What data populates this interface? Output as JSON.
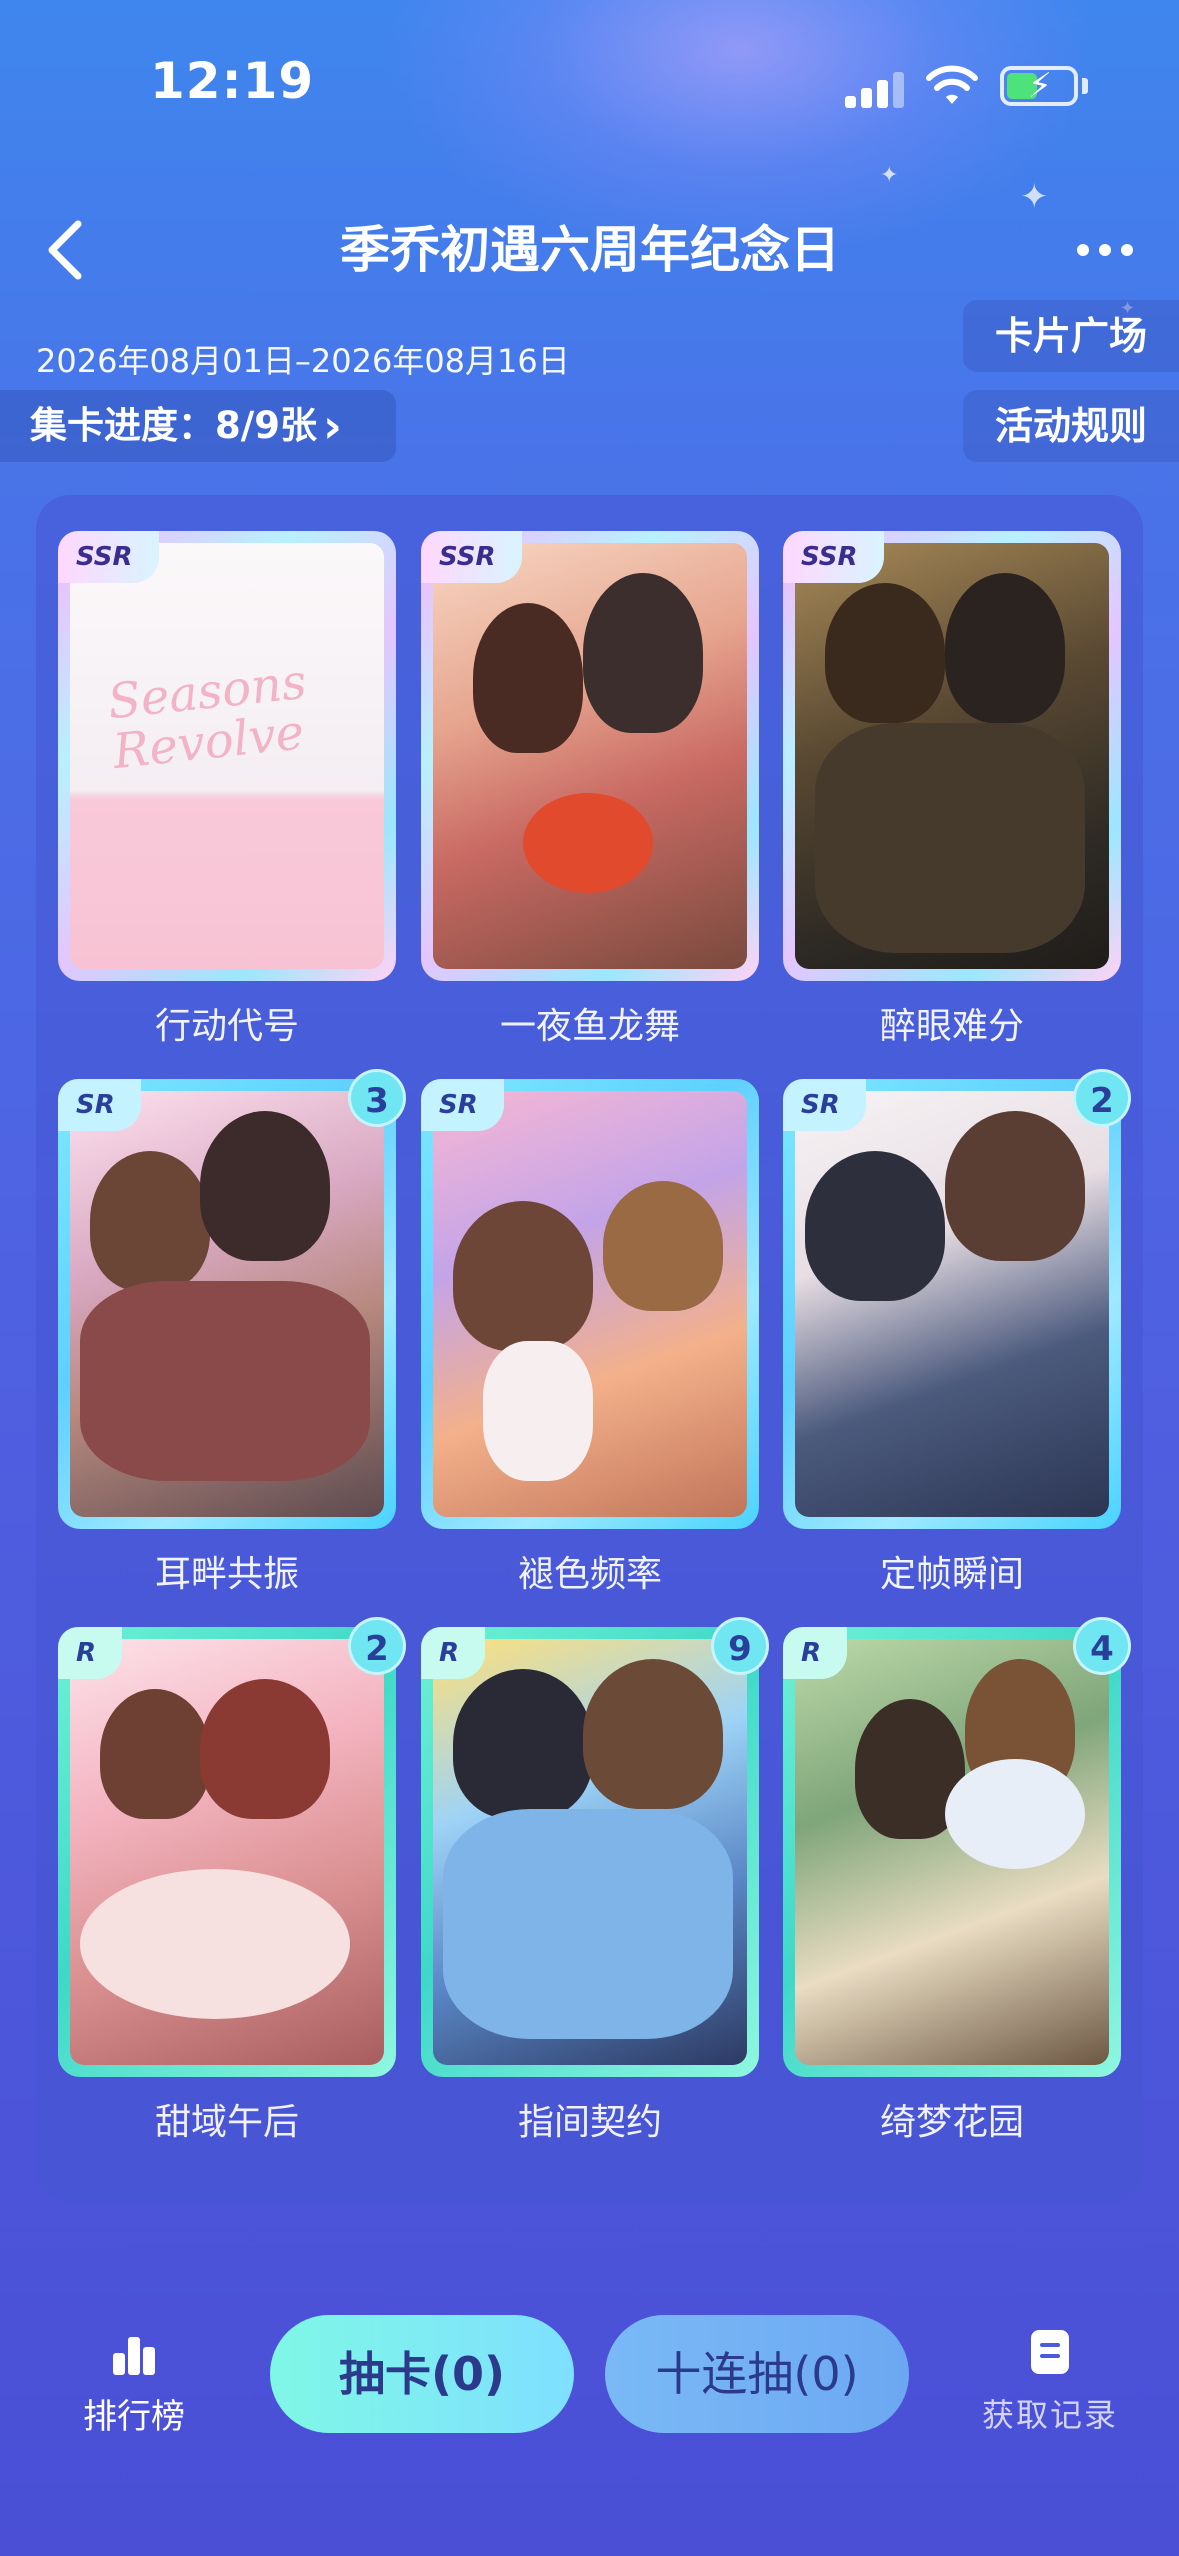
{
  "status_bar": {
    "time": "12:19"
  },
  "header": {
    "title": "季乔初遇六周年纪念日",
    "date_range": "2026年08月01日–2026年08月16日",
    "card_plaza": "卡片广场",
    "rules": "活动规则",
    "progress_label": "集卡进度：8/9张",
    "progress_chevron": "›"
  },
  "cards": [
    {
      "rarity": "SSR",
      "name": "行动代号",
      "count": "",
      "logo": "Seasons Revolve"
    },
    {
      "rarity": "SSR",
      "name": "一夜鱼龙舞",
      "count": ""
    },
    {
      "rarity": "SSR",
      "name": "醉眼难分",
      "count": ""
    },
    {
      "rarity": "SR",
      "name": "耳畔共振",
      "count": "3"
    },
    {
      "rarity": "SR",
      "name": "褪色频率",
      "count": ""
    },
    {
      "rarity": "SR",
      "name": "定帧瞬间",
      "count": "2"
    },
    {
      "rarity": "R",
      "name": "甜域午后",
      "count": "2"
    },
    {
      "rarity": "R",
      "name": "指间契约",
      "count": "9"
    },
    {
      "rarity": "R",
      "name": "绮梦花园",
      "count": "4"
    }
  ],
  "bottom_bar": {
    "ranking": "排行榜",
    "draw": "抽卡(0)",
    "draw_ten": "十连抽(0)",
    "record": "获取记录"
  },
  "colors": {
    "background": "#4a6ae6",
    "draw_button": "#7ff7e6",
    "draw_ten_button": "#74b2f4",
    "badge": "#6fe6f2",
    "button_text": "#2b3a8a"
  }
}
